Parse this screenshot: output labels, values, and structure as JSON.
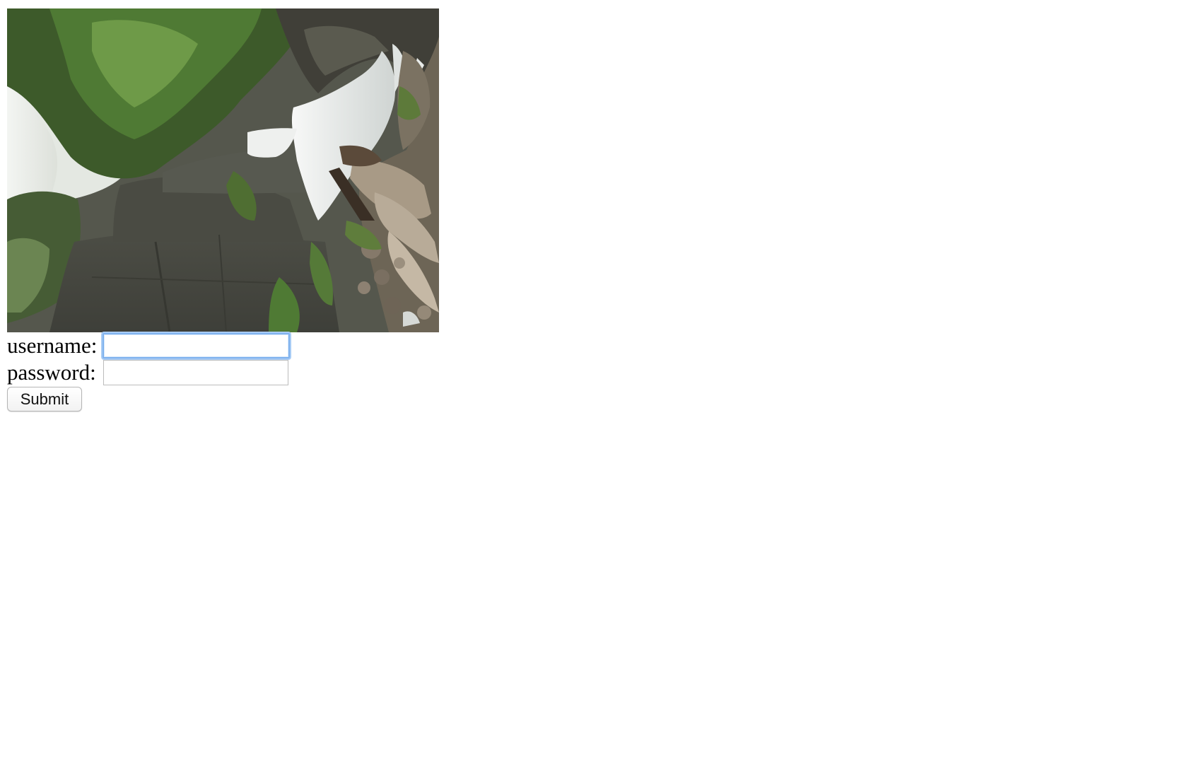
{
  "photo": {
    "subject": "waterfall-landscape-photo",
    "alt": ""
  },
  "form": {
    "username": {
      "label": "username:",
      "value": "",
      "placeholder": "",
      "focused": true
    },
    "password": {
      "label": "password:",
      "value": "",
      "placeholder": ""
    },
    "submit_label": "Submit"
  },
  "colors": {
    "page_background": "#ffffff",
    "focus_ring": "#7fb2ee",
    "input_border": "#b9b9b9"
  }
}
